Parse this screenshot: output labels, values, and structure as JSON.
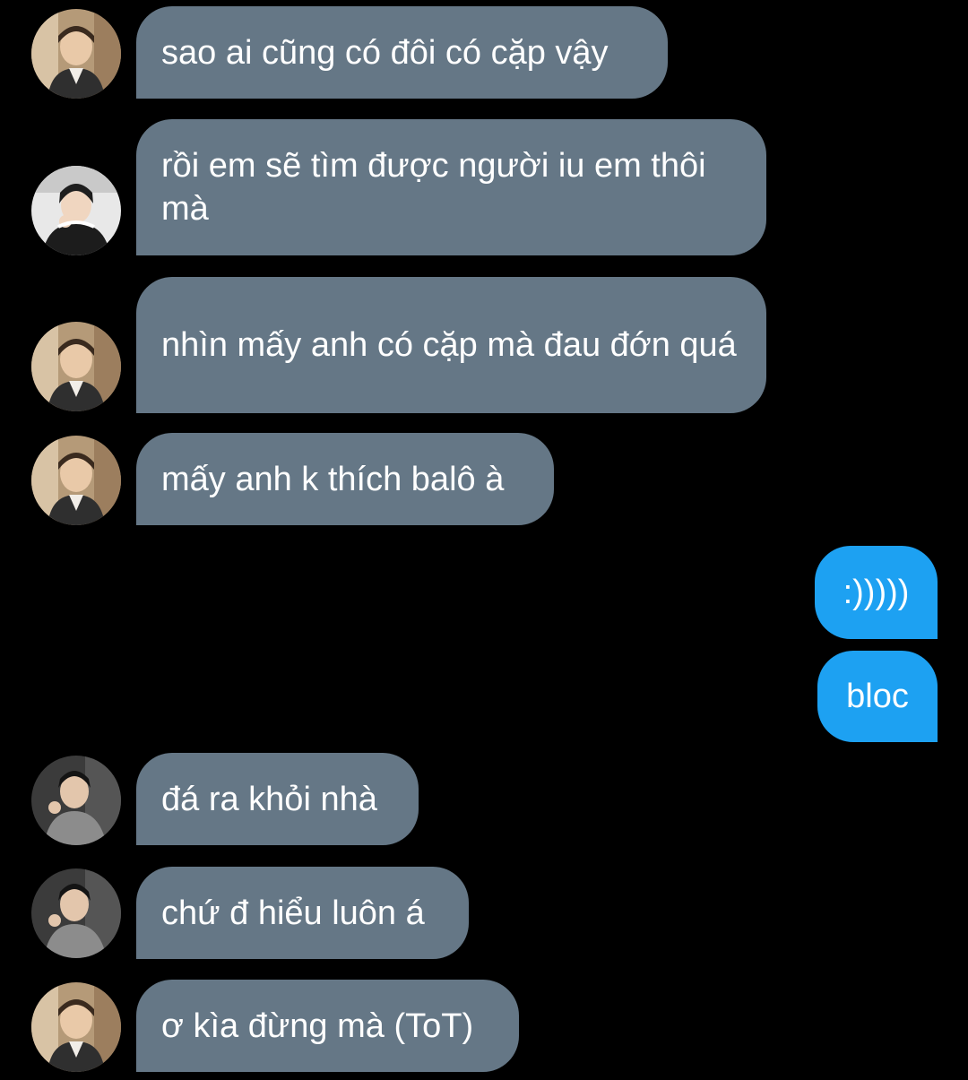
{
  "messages": [
    {
      "direction": "in",
      "avatar": "avatar-a",
      "text": "sao ai cũng có đôi có cặp vậy"
    },
    {
      "direction": "in",
      "avatar": "avatar-b",
      "text": "rồi em sẽ tìm được người iu em thôi mà"
    },
    {
      "direction": "in",
      "avatar": "avatar-a",
      "text": "nhìn mấy anh có cặp mà đau đớn quá"
    },
    {
      "direction": "in",
      "avatar": "avatar-a",
      "text": "mấy anh k thích balô à"
    },
    {
      "direction": "out",
      "avatar": "",
      "text": ":)))))"
    },
    {
      "direction": "out",
      "avatar": "",
      "text": "bloc"
    },
    {
      "direction": "in",
      "avatar": "avatar-c",
      "text": "đá ra khỏi nhà"
    },
    {
      "direction": "in",
      "avatar": "avatar-c",
      "text": "chứ đ hiểu luôn á"
    },
    {
      "direction": "in",
      "avatar": "avatar-a",
      "text": "ơ kìa đừng mà (ToT)"
    }
  ],
  "colors": {
    "background": "#000000",
    "incoming_bubble": "#657786",
    "outgoing_bubble": "#1da1f2",
    "text": "#ffffff"
  }
}
